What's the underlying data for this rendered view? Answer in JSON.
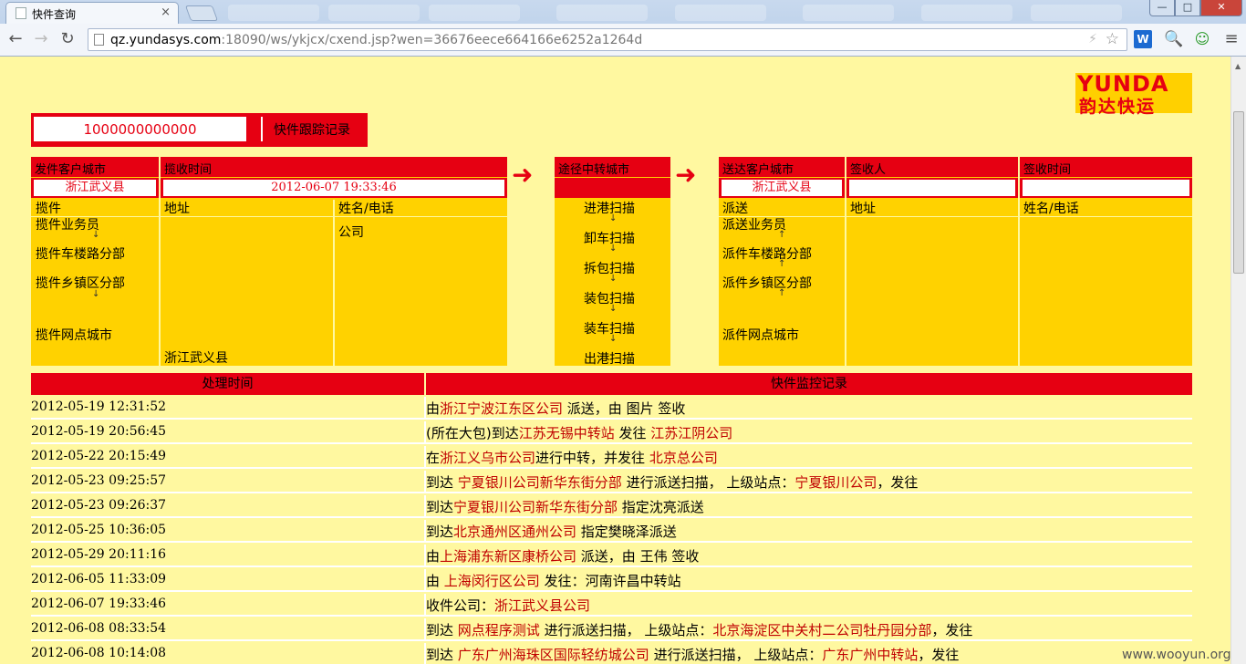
{
  "browser": {
    "tab_title": "快件查询",
    "tab_close": "×",
    "url_host": "qz.yundasys.com",
    "url_rest": ":18090/ws/ykjcx/cxend.jsp?wen=36676eece664166e6252a1264d",
    "back": "←",
    "forward": "→",
    "reload": "↻",
    "bolt": "⚡",
    "star": "☆",
    "ext_w": "W",
    "ext_s": "🔍",
    "ext_g": "☺",
    "ext_m": "≡",
    "win_min": "—",
    "win_max": "□",
    "win_close": "✕"
  },
  "logo": {
    "line1": "YUNDA",
    "line2": "韵达快运"
  },
  "search": {
    "value": "1000000000000",
    "title": "快件跟踪记录"
  },
  "send": {
    "col1_header": "发件客户城市",
    "col2_header": "揽收时间",
    "city": "浙江武义县",
    "time": "2012-06-07 19:33:46",
    "sub1": "揽件",
    "sub2": "地址",
    "sub3": "姓名/电话",
    "steps": [
      "揽件业务员",
      "揽件车楼路分部",
      "揽件乡镇区分部",
      "揽件网点城市"
    ],
    "address": "浙江武义县",
    "name": "公司"
  },
  "transit": {
    "header": "途径中转城市",
    "steps": [
      "进港扫描",
      "卸车扫描",
      "拆包扫描",
      "装包扫描",
      "装车扫描",
      "出港扫描"
    ]
  },
  "deliver": {
    "col1_header": "送达客户城市",
    "col2_header": "签收人",
    "col3_header": "签收时间",
    "city": "浙江武义县",
    "sub1": "派送",
    "sub2": "地址",
    "sub3": "姓名/电话",
    "steps": [
      "派送业务员",
      "派件车楼路分部",
      "派件乡镇区分部",
      "派件网点城市"
    ]
  },
  "monitor": {
    "col_time": "处理时间",
    "col_record": "快件监控记录",
    "rows": [
      {
        "time": "2012-05-19 12:31:52",
        "p1": "由",
        "h1": "浙江宁波江东区公司",
        "p2": " 派送，由 图片 签收",
        "h2": "",
        "p3": ""
      },
      {
        "time": "2012-05-19 20:56:45",
        "p1": "(所在大包)到达",
        "h1": "江苏无锡中转站",
        "p2": " 发往 ",
        "h2": "江苏江阴公司",
        "p3": ""
      },
      {
        "time": "2012-05-22 20:15:49",
        "p1": "在",
        "h1": "浙江义乌市公司",
        "p2": "进行中转，并发往 ",
        "h2": "北京总公司",
        "p3": ""
      },
      {
        "time": "2012-05-23 09:25:57",
        "p1": "到达 ",
        "h1": "宁夏银川公司新华东街分部",
        "p2": " 进行派送扫描， 上级站点：",
        "h2": "宁夏银川公司",
        "p3": "，发往"
      },
      {
        "time": "2012-05-23 09:26:37",
        "p1": "到达",
        "h1": "宁夏银川公司新华东街分部",
        "p2": " 指定沈亮派送",
        "h2": "",
        "p3": ""
      },
      {
        "time": "2012-05-25 10:36:05",
        "p1": "到达",
        "h1": "北京通州区通州公司",
        "p2": " 指定樊晓泽派送",
        "h2": "",
        "p3": ""
      },
      {
        "time": "2012-05-29 20:11:16",
        "p1": "由",
        "h1": "上海浦东新区康桥公司",
        "p2": " 派送，由 王伟 签收",
        "h2": "",
        "p3": ""
      },
      {
        "time": "2012-06-05 11:33:09",
        "p1": "由 ",
        "h1": "上海闵行区公司",
        "p2": " 发往：河南许昌中转站",
        "h2": "",
        "p3": ""
      },
      {
        "time": "2012-06-07 19:33:46",
        "p1": "收件公司：",
        "h1": "浙江武义县公司",
        "p2": "",
        "h2": "",
        "p3": ""
      },
      {
        "time": "2012-06-08 08:33:54",
        "p1": "到达 ",
        "h1": "网点程序测试",
        "p2": " 进行派送扫描， 上级站点：",
        "h2": "北京海淀区中关村二公司牡丹园分部",
        "p3": "，发往"
      },
      {
        "time": "2012-06-08 10:14:08",
        "p1": "到达 ",
        "h1": "广东广州海珠区国际轻纺城公司",
        "p2": " 进行派送扫描， 上级站点：",
        "h2": "广东广州中转站",
        "p3": "，发往"
      }
    ]
  },
  "watermark": "www.wooyun.org"
}
